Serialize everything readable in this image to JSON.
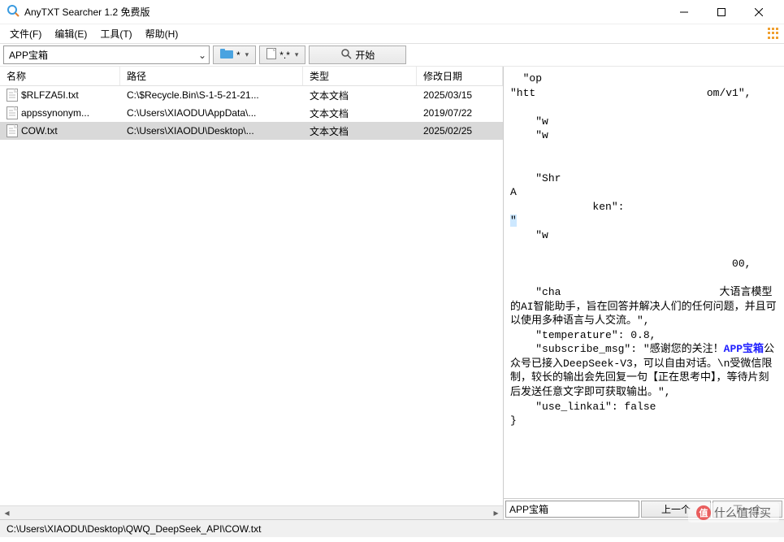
{
  "window": {
    "title": "AnyTXT Searcher 1.2 免费版"
  },
  "menu": {
    "file": "文件(F)",
    "edit": "编辑(E)",
    "tools": "工具(T)",
    "help": "帮助(H)"
  },
  "toolbar": {
    "search_value": "APP宝箱",
    "filter1": "*",
    "filter2": "*.*",
    "start_label": "开始"
  },
  "columns": {
    "name": "名称",
    "path": "路径",
    "type": "类型",
    "date": "修改日期"
  },
  "rows": [
    {
      "name": "$RLFZA5I.txt",
      "path": "C:\\$Recycle.Bin\\S-1-5-21-21...",
      "type": "文本文档",
      "date": "2025/03/15",
      "selected": false
    },
    {
      "name": "appssynonym...",
      "path": "C:\\Users\\XIAODU\\AppData\\...",
      "type": "文本文档",
      "date": "2019/07/22",
      "selected": false
    },
    {
      "name": "COW.txt",
      "path": "C:\\Users\\XIAODU\\Desktop\\...",
      "type": "文本文档",
      "date": "2025/02/25",
      "selected": true
    }
  ],
  "preview": {
    "frag_op": "  \"op",
    "frag_htt": "\"htt                           om/v1\",",
    "frag_w1": "    \"w",
    "frag_w2": "    \"w",
    "frag_shr": "    \"Shr",
    "frag_A": "A",
    "frag_ken": "             ken\":",
    "frag_sel": "\"",
    "frag_w3": "    \"w",
    "frag_00": "                                   00,",
    "frag_cha": "    \"cha                         大语言模型的AI智能助手，旨在回答并解决人们的任何问题，并且可以使用多种语言与人交流。\",",
    "line_temp": "    \"temperature\": 0.8,",
    "sub_pre": "    \"subscribe_msg\": \"感谢您的关注！",
    "sub_hl1": "APP宝箱",
    "sub_mid": "公众号已接入DeepSeek-V3，可以自由对话。\\n受微信限制，较长的输出会先回复一句【正在思考中】，等待片刻后发送任意文字即可获取输出。\",",
    "line_linkai": "    \"use_linkai\": false",
    "line_end": "}"
  },
  "right_bottom": {
    "find_value": "APP宝箱",
    "prev": "上一个",
    "next": "下一个"
  },
  "statusbar": {
    "path": "C:\\Users\\XIAODU\\Desktop\\QWQ_DeepSeek_API\\COW.txt"
  },
  "watermark": {
    "text": "什么值得买",
    "badge": "值"
  }
}
